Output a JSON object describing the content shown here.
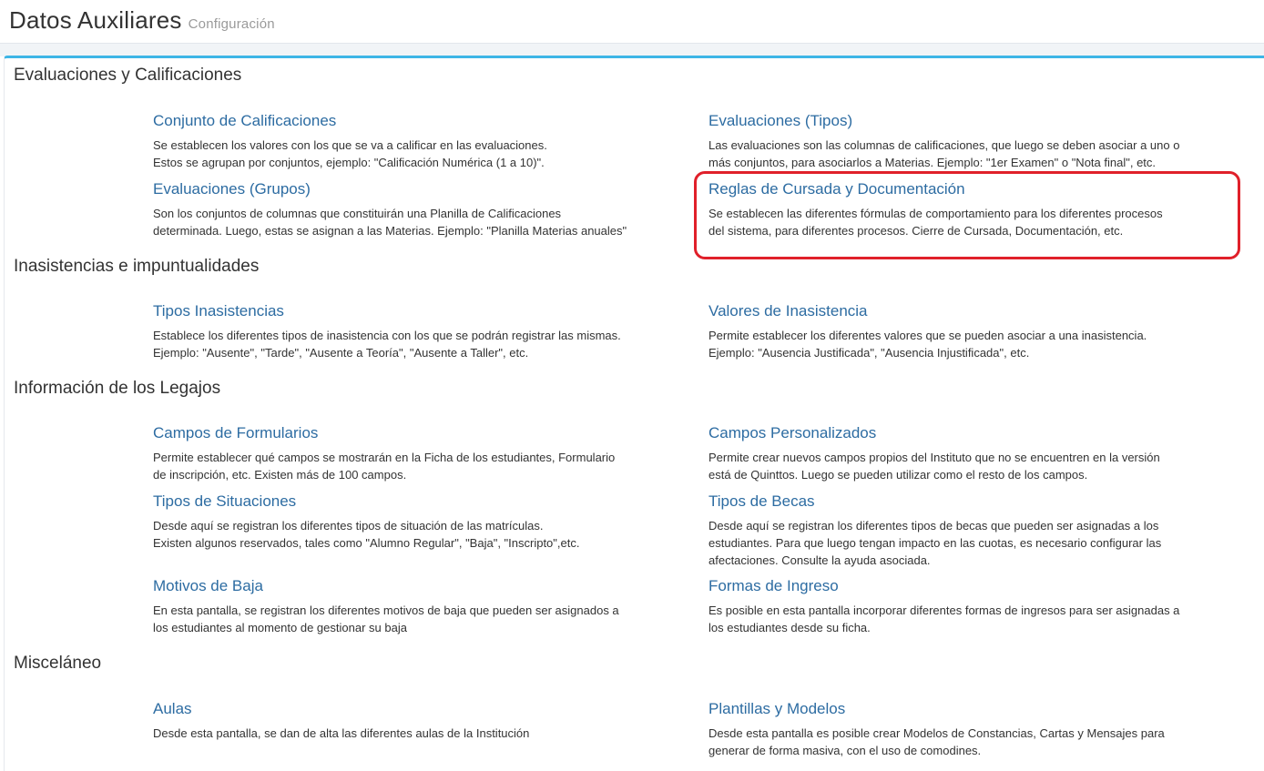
{
  "header": {
    "title": "Datos Auxiliares",
    "subtitle": "Configuración"
  },
  "sections": [
    {
      "title": "Evaluaciones y Calificaciones",
      "items": [
        {
          "label": "Conjunto de Calificaciones",
          "lines": [
            "Se establecen los valores con los que se va a calificar en las evaluaciones.",
            "Estos se agrupan por conjuntos, ejemplo: \"Calificación Numérica (1 a 10)\"."
          ]
        },
        {
          "label": "Evaluaciones (Tipos)",
          "lines": [
            "Las evaluaciones son las columnas de calificaciones, que luego se deben asociar a uno o",
            "más conjuntos, para asociarlos a Materias. Ejemplo: \"1er Examen\" o \"Nota final\", etc."
          ]
        },
        {
          "label": "Evaluaciones (Grupos)",
          "lines": [
            "Son los conjuntos de columnas que constituirán una Planilla de Calificaciones",
            "determinada. Luego, estas se asignan a las Materias. Ejemplo: \"Planilla Materias anuales\""
          ]
        },
        {
          "label": "Reglas de Cursada y Documentación",
          "lines": [
            "Se establecen las diferentes fórmulas de comportamiento para los diferentes procesos",
            "del sistema, para diferentes procesos. Cierre de Cursada, Documentación, etc."
          ]
        }
      ]
    },
    {
      "title": "Inasistencias e impuntualidades",
      "items": [
        {
          "label": "Tipos Inasistencias",
          "lines": [
            "Establece los diferentes tipos de inasistencia con los que se podrán registrar las mismas.",
            "Ejemplo: \"Ausente\", \"Tarde\", \"Ausente a Teoría\", \"Ausente a Taller\", etc."
          ]
        },
        {
          "label": "Valores de Inasistencia",
          "lines": [
            "Permite establecer los diferentes valores que se pueden asociar a una inasistencia.",
            "Ejemplo: \"Ausencia Justificada\", \"Ausencia Injustificada\", etc."
          ]
        }
      ]
    },
    {
      "title": "Información de los Legajos",
      "items": [
        {
          "label": "Campos de Formularios",
          "lines": [
            "Permite establecer qué campos se mostrarán en la Ficha de los estudiantes, Formulario",
            "de inscripción, etc. Existen más de 100 campos."
          ]
        },
        {
          "label": "Campos Personalizados",
          "lines": [
            "Permite crear nuevos campos propios del Instituto que no se encuentren en la versión",
            "está de Quinttos. Luego se pueden utilizar como el resto de los campos."
          ]
        },
        {
          "label": "Tipos de Situaciones",
          "lines": [
            "Desde aquí se registran los diferentes tipos de situación de las matrículas.",
            "Existen algunos reservados, tales como \"Alumno Regular\", \"Baja\", \"Inscripto\",etc."
          ]
        },
        {
          "label": "Tipos de Becas",
          "lines": [
            "Desde aquí se registran los diferentes tipos de becas que pueden ser asignadas a los",
            "estudiantes. Para que luego tengan impacto en las cuotas, es necesario configurar las",
            "afectaciones. Consulte la ayuda asociada."
          ]
        },
        {
          "label": "Motivos de Baja",
          "lines": [
            "En esta pantalla, se registran los diferentes motivos de baja que pueden ser asignados a",
            "los estudiantes al momento de gestionar su baja"
          ]
        },
        {
          "label": "Formas de Ingreso",
          "lines": [
            "Es posible en esta pantalla incorporar diferentes formas de ingresos para ser asignadas a",
            "los estudiantes desde su ficha."
          ]
        }
      ]
    },
    {
      "title": "Misceláneo",
      "items": [
        {
          "label": "Aulas",
          "lines": [
            "Desde esta pantalla, se dan de alta las diferentes aulas de la Institución"
          ]
        },
        {
          "label": "Plantillas y Modelos",
          "lines": [
            "Desde esta pantalla es posible crear Modelos de Constancias, Cartas y Mensajes para",
            "generar de forma masiva, con el uso de comodines."
          ]
        }
      ]
    }
  ],
  "colors": {
    "link": "#2d6ca2",
    "panel_top_border": "#3db5e6",
    "highlight": "#e0202a"
  }
}
